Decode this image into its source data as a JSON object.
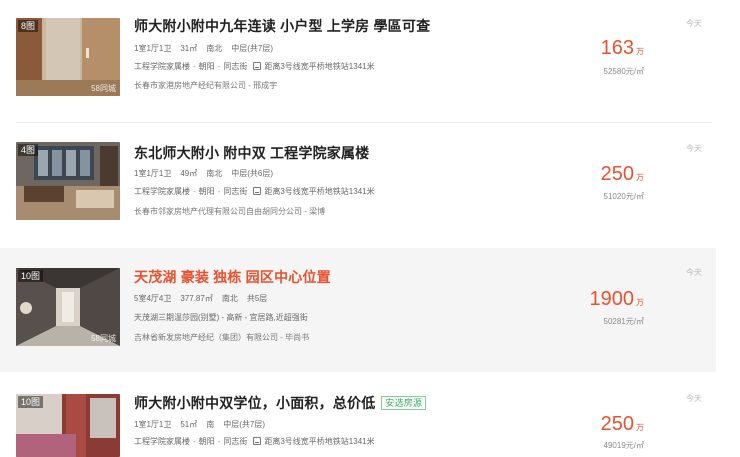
{
  "listings": [
    {
      "photo_count": "8图",
      "watermark": "58同城",
      "title": "师大附小附中九年连读 小户型 上学房 學區可查",
      "layout": "1室1厅1卫",
      "area": "31㎡",
      "orientation": "南北",
      "floor": "中层(共7层)",
      "community": "工程学院家属楼",
      "district": "朝阳",
      "street": "同志街",
      "subway": "距离3号线宽平桥地铁站1341米",
      "agency": "长春市家港房地产经纪有限公司 - 邢成宇",
      "price": "163",
      "price_unit": "万",
      "unit_price": "52580元/㎡",
      "date": "今天"
    },
    {
      "photo_count": "4图",
      "watermark": "",
      "title": "东北师大附小 附中双 工程学院家属楼",
      "layout": "1室1厅1卫",
      "area": "49㎡",
      "orientation": "南北",
      "floor": "中层(共6层)",
      "community": "工程学院家属楼",
      "district": "朝阳",
      "street": "同志街",
      "subway": "距离3号线宽平桥地铁站1341米",
      "agency": "长春市邻家房地产代理有限公司自由胡同分公司 - 梁博",
      "price": "250",
      "price_unit": "万",
      "unit_price": "51020元/㎡",
      "date": "今天"
    },
    {
      "photo_count": "10图",
      "watermark": "58同城",
      "title": "天茂湖 豪装 独栋 园区中心位置",
      "layout": "5室4厅4卫",
      "area": "377.87㎡",
      "orientation": "南北",
      "floor": "共5层",
      "location_line": "天茂湖三期温莎园(别墅) - 高新 - 宜居路,近超强街",
      "agency": "吉林省新发房地产经纪（集团）有限公司 - 毕尚书",
      "price": "1900",
      "price_unit": "万",
      "unit_price": "50281元/㎡",
      "date": "今天"
    },
    {
      "photo_count": "10图",
      "watermark": "",
      "title": "师大附小附中双学位，小面积，总价低",
      "tag": "安选房源",
      "layout": "1室1厅1卫",
      "area": "51㎡",
      "orientation": "南",
      "floor": "中层(共7层)",
      "community": "工程学院家属楼",
      "district": "朝阳",
      "street": "同志街",
      "subway": "距离3号线宽平桥地铁站1341米",
      "price": "250",
      "price_unit": "万",
      "unit_price": "49019元/㎡",
      "date": "今天"
    }
  ],
  "colors": {
    "price": "#e8522f",
    "hot_title": "#e8522f",
    "tag": "#3aaa5e",
    "highlight_bg": "#f5f5f5"
  }
}
